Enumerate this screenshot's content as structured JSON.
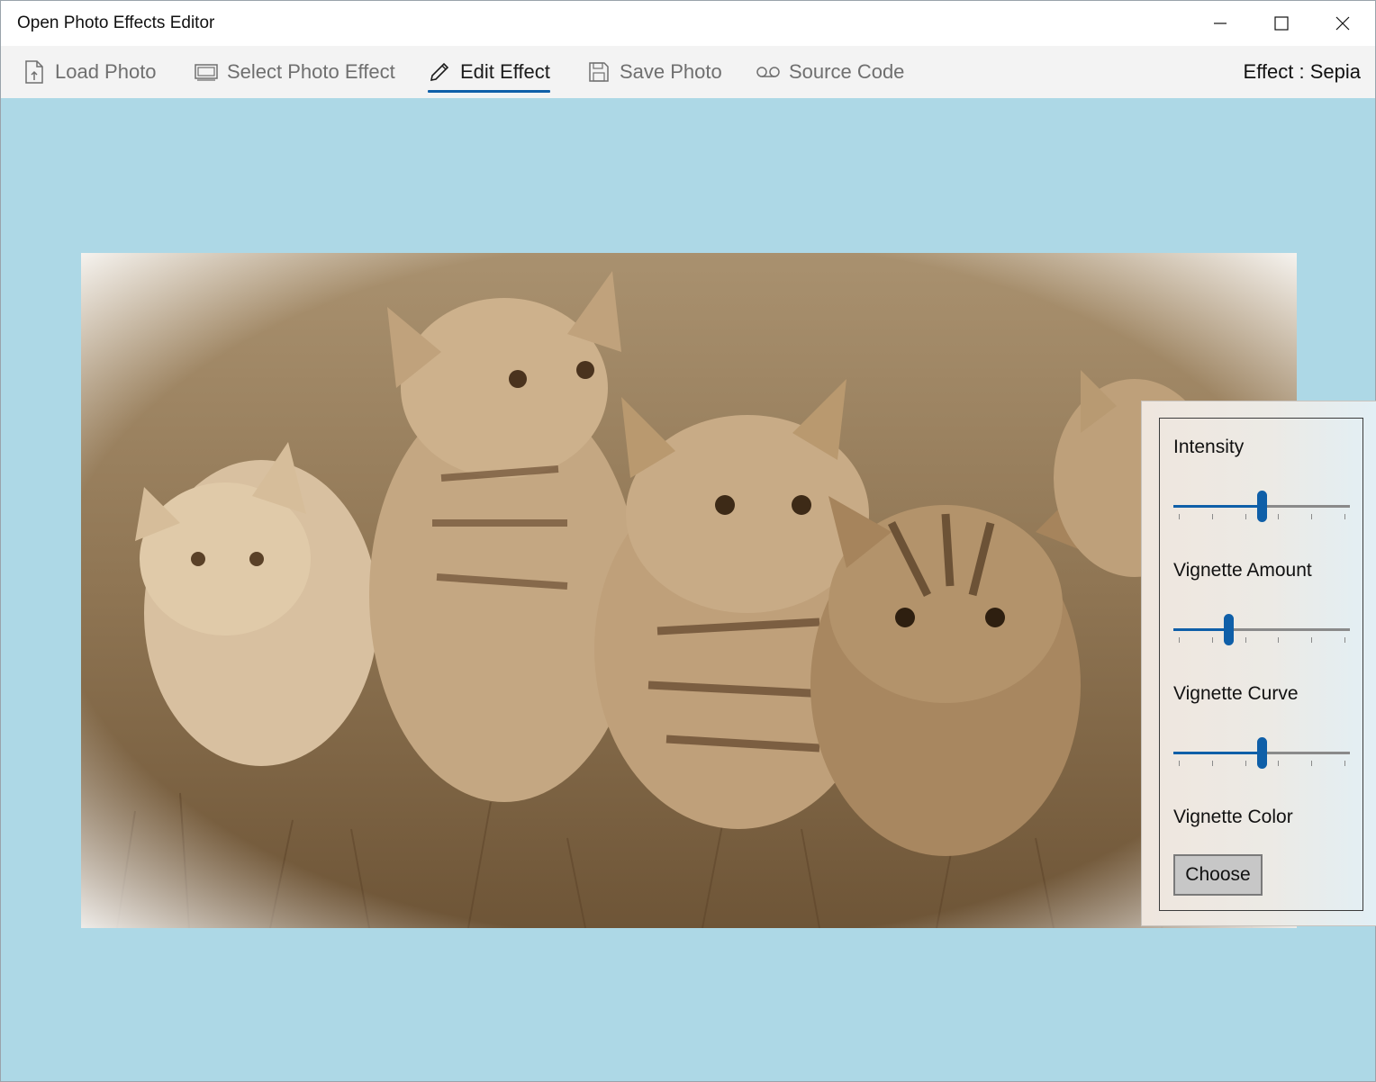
{
  "window": {
    "title": "Open Photo Effects Editor"
  },
  "toolbar": {
    "items": [
      {
        "label": "Load Photo",
        "icon": "load-file-icon"
      },
      {
        "label": "Select Photo Effect",
        "icon": "photo-gallery-icon"
      },
      {
        "label": "Edit Effect",
        "icon": "pencil-icon",
        "active": true
      },
      {
        "label": "Save Photo",
        "icon": "save-icon"
      },
      {
        "label": "Source Code",
        "icon": "voicemail-icon"
      }
    ],
    "effect_status": "Effect :  Sepia"
  },
  "photo": {
    "description_icon": "kittens-photo-sepia",
    "effect": "Sepia"
  },
  "panel": {
    "intensity": {
      "label": "Intensity",
      "value": 0.5
    },
    "vignette_amount": {
      "label": "Vignette Amount",
      "value": 0.31
    },
    "vignette_curve": {
      "label": "Vignette Curve",
      "value": 0.5
    },
    "vignette_color": {
      "label": "Vignette Color",
      "button_label": "Choose"
    }
  },
  "colors": {
    "accent": "#0f5fa8",
    "background": "#add8e6",
    "sepia": "#a88c68"
  }
}
